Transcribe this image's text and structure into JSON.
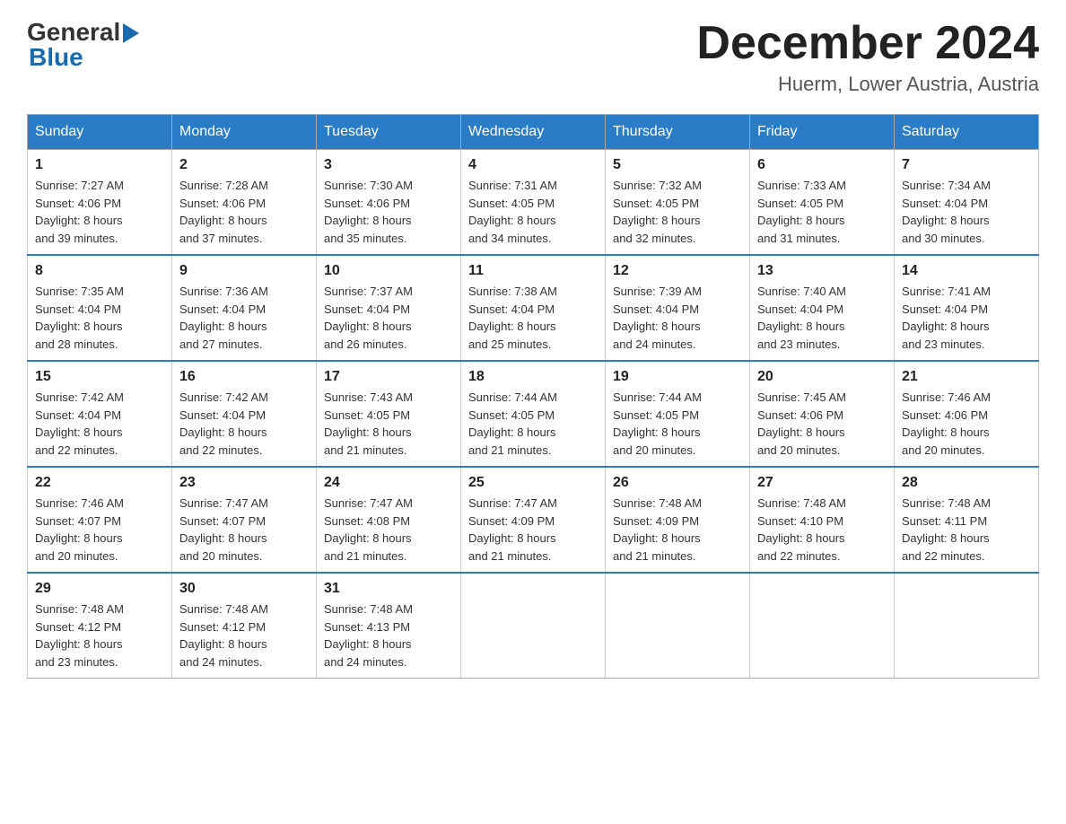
{
  "logo": {
    "text_general": "General",
    "text_blue": "Blue"
  },
  "title": {
    "month_year": "December 2024",
    "location": "Huerm, Lower Austria, Austria"
  },
  "weekdays": [
    "Sunday",
    "Monday",
    "Tuesday",
    "Wednesday",
    "Thursday",
    "Friday",
    "Saturday"
  ],
  "weeks": [
    [
      {
        "day": "1",
        "sunrise": "7:27 AM",
        "sunset": "4:06 PM",
        "daylight": "8 hours and 39 minutes."
      },
      {
        "day": "2",
        "sunrise": "7:28 AM",
        "sunset": "4:06 PM",
        "daylight": "8 hours and 37 minutes."
      },
      {
        "day": "3",
        "sunrise": "7:30 AM",
        "sunset": "4:06 PM",
        "daylight": "8 hours and 35 minutes."
      },
      {
        "day": "4",
        "sunrise": "7:31 AM",
        "sunset": "4:05 PM",
        "daylight": "8 hours and 34 minutes."
      },
      {
        "day": "5",
        "sunrise": "7:32 AM",
        "sunset": "4:05 PM",
        "daylight": "8 hours and 32 minutes."
      },
      {
        "day": "6",
        "sunrise": "7:33 AM",
        "sunset": "4:05 PM",
        "daylight": "8 hours and 31 minutes."
      },
      {
        "day": "7",
        "sunrise": "7:34 AM",
        "sunset": "4:04 PM",
        "daylight": "8 hours and 30 minutes."
      }
    ],
    [
      {
        "day": "8",
        "sunrise": "7:35 AM",
        "sunset": "4:04 PM",
        "daylight": "8 hours and 28 minutes."
      },
      {
        "day": "9",
        "sunrise": "7:36 AM",
        "sunset": "4:04 PM",
        "daylight": "8 hours and 27 minutes."
      },
      {
        "day": "10",
        "sunrise": "7:37 AM",
        "sunset": "4:04 PM",
        "daylight": "8 hours and 26 minutes."
      },
      {
        "day": "11",
        "sunrise": "7:38 AM",
        "sunset": "4:04 PM",
        "daylight": "8 hours and 25 minutes."
      },
      {
        "day": "12",
        "sunrise": "7:39 AM",
        "sunset": "4:04 PM",
        "daylight": "8 hours and 24 minutes."
      },
      {
        "day": "13",
        "sunrise": "7:40 AM",
        "sunset": "4:04 PM",
        "daylight": "8 hours and 23 minutes."
      },
      {
        "day": "14",
        "sunrise": "7:41 AM",
        "sunset": "4:04 PM",
        "daylight": "8 hours and 23 minutes."
      }
    ],
    [
      {
        "day": "15",
        "sunrise": "7:42 AM",
        "sunset": "4:04 PM",
        "daylight": "8 hours and 22 minutes."
      },
      {
        "day": "16",
        "sunrise": "7:42 AM",
        "sunset": "4:04 PM",
        "daylight": "8 hours and 22 minutes."
      },
      {
        "day": "17",
        "sunrise": "7:43 AM",
        "sunset": "4:05 PM",
        "daylight": "8 hours and 21 minutes."
      },
      {
        "day": "18",
        "sunrise": "7:44 AM",
        "sunset": "4:05 PM",
        "daylight": "8 hours and 21 minutes."
      },
      {
        "day": "19",
        "sunrise": "7:44 AM",
        "sunset": "4:05 PM",
        "daylight": "8 hours and 20 minutes."
      },
      {
        "day": "20",
        "sunrise": "7:45 AM",
        "sunset": "4:06 PM",
        "daylight": "8 hours and 20 minutes."
      },
      {
        "day": "21",
        "sunrise": "7:46 AM",
        "sunset": "4:06 PM",
        "daylight": "8 hours and 20 minutes."
      }
    ],
    [
      {
        "day": "22",
        "sunrise": "7:46 AM",
        "sunset": "4:07 PM",
        "daylight": "8 hours and 20 minutes."
      },
      {
        "day": "23",
        "sunrise": "7:47 AM",
        "sunset": "4:07 PM",
        "daylight": "8 hours and 20 minutes."
      },
      {
        "day": "24",
        "sunrise": "7:47 AM",
        "sunset": "4:08 PM",
        "daylight": "8 hours and 21 minutes."
      },
      {
        "day": "25",
        "sunrise": "7:47 AM",
        "sunset": "4:09 PM",
        "daylight": "8 hours and 21 minutes."
      },
      {
        "day": "26",
        "sunrise": "7:48 AM",
        "sunset": "4:09 PM",
        "daylight": "8 hours and 21 minutes."
      },
      {
        "day": "27",
        "sunrise": "7:48 AM",
        "sunset": "4:10 PM",
        "daylight": "8 hours and 22 minutes."
      },
      {
        "day": "28",
        "sunrise": "7:48 AM",
        "sunset": "4:11 PM",
        "daylight": "8 hours and 22 minutes."
      }
    ],
    [
      {
        "day": "29",
        "sunrise": "7:48 AM",
        "sunset": "4:12 PM",
        "daylight": "8 hours and 23 minutes."
      },
      {
        "day": "30",
        "sunrise": "7:48 AM",
        "sunset": "4:12 PM",
        "daylight": "8 hours and 24 minutes."
      },
      {
        "day": "31",
        "sunrise": "7:48 AM",
        "sunset": "4:13 PM",
        "daylight": "8 hours and 24 minutes."
      },
      null,
      null,
      null,
      null
    ]
  ],
  "labels": {
    "sunrise": "Sunrise:",
    "sunset": "Sunset:",
    "daylight": "Daylight:"
  }
}
